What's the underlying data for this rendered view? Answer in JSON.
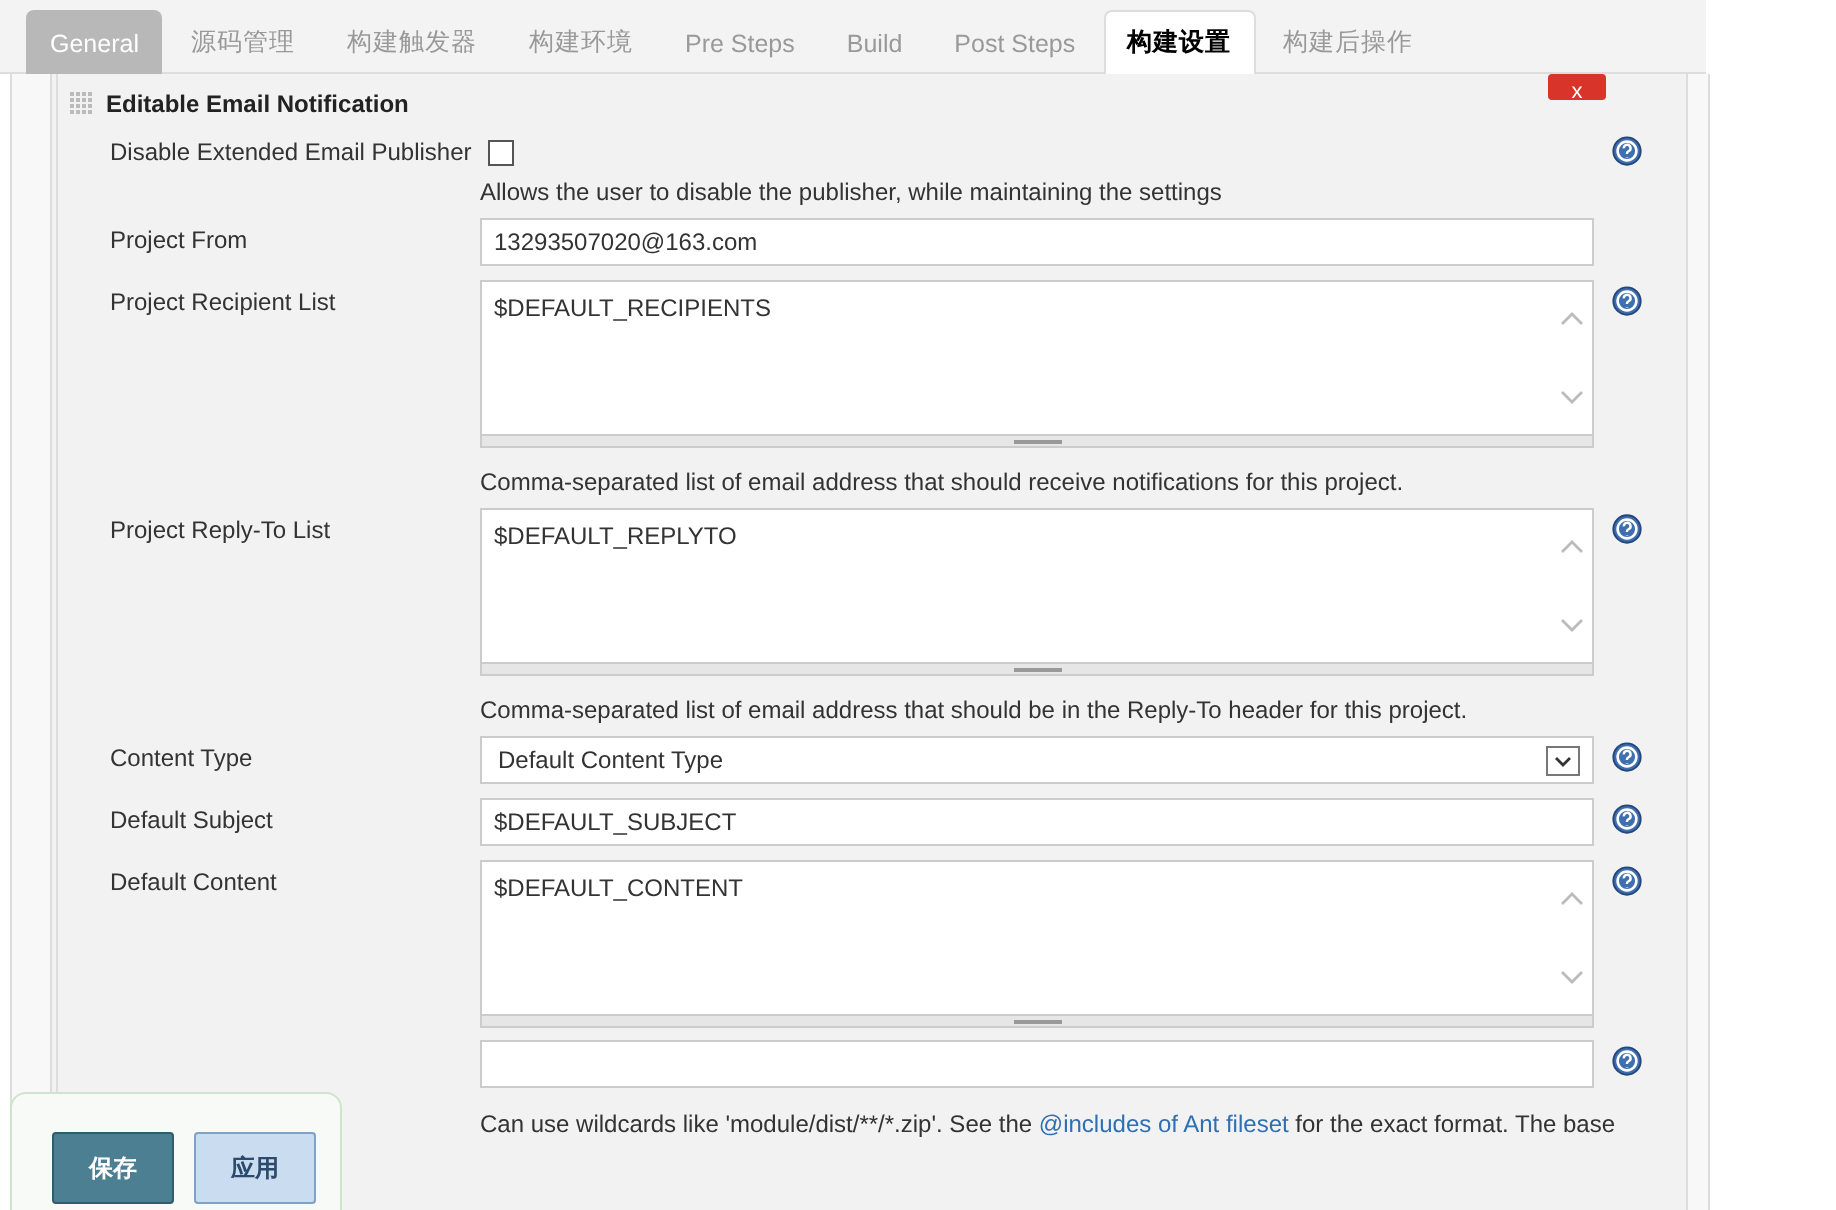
{
  "tabs": [
    {
      "label": "General",
      "kind": "primary",
      "selected": false
    },
    {
      "label": "源码管理",
      "kind": "tab",
      "selected": false
    },
    {
      "label": "构建触发器",
      "kind": "tab",
      "selected": false
    },
    {
      "label": "构建环境",
      "kind": "tab",
      "selected": false
    },
    {
      "label": "Pre Steps",
      "kind": "tab",
      "selected": false
    },
    {
      "label": "Build",
      "kind": "tab",
      "selected": false
    },
    {
      "label": "Post Steps",
      "kind": "tab",
      "selected": false
    },
    {
      "label": "构建设置",
      "kind": "tab",
      "selected": true
    },
    {
      "label": "构建后操作",
      "kind": "tab",
      "selected": false
    }
  ],
  "section": {
    "title": "Editable Email Notification",
    "close": "x"
  },
  "rows": [
    {
      "kind": "checkbox",
      "label": "Disable Extended Email Publisher",
      "checked": false,
      "help": true
    },
    {
      "kind": "description",
      "text": "Allows the user to disable the publisher, while maintaining the settings"
    },
    {
      "kind": "text",
      "label": "Project From",
      "value": "13293507020@163.com",
      "help": false
    },
    {
      "kind": "textarea",
      "label": "Project Recipient List",
      "value": "$DEFAULT_RECIPIENTS",
      "help": true
    },
    {
      "kind": "description",
      "text": "Comma-separated list of email address that should receive notifications for this project."
    },
    {
      "kind": "textarea",
      "label": "Project Reply-To List",
      "value": "$DEFAULT_REPLYTO",
      "help": true
    },
    {
      "kind": "description",
      "text": "Comma-separated list of email address that should be in the Reply-To header for this project."
    },
    {
      "kind": "select",
      "label": "Content Type",
      "value": "Default Content Type",
      "help": true
    },
    {
      "kind": "text",
      "label": "Default Subject",
      "value": "$DEFAULT_SUBJECT",
      "help": true
    },
    {
      "kind": "textarea",
      "label": "Default Content",
      "value": "$DEFAULT_CONTENT",
      "help": true
    },
    {
      "kind": "text",
      "value": "",
      "help": true
    },
    {
      "kind": "description",
      "text": "Can use wildcards like 'module/dist/**/*.zip'. See the",
      "link": "@includes of Ant fileset",
      "after": "for the exact format. The base"
    }
  ],
  "buttons": [
    {
      "label": "保存",
      "kind": "primary"
    },
    {
      "label": "应用",
      "kind": "secondary"
    }
  ]
}
